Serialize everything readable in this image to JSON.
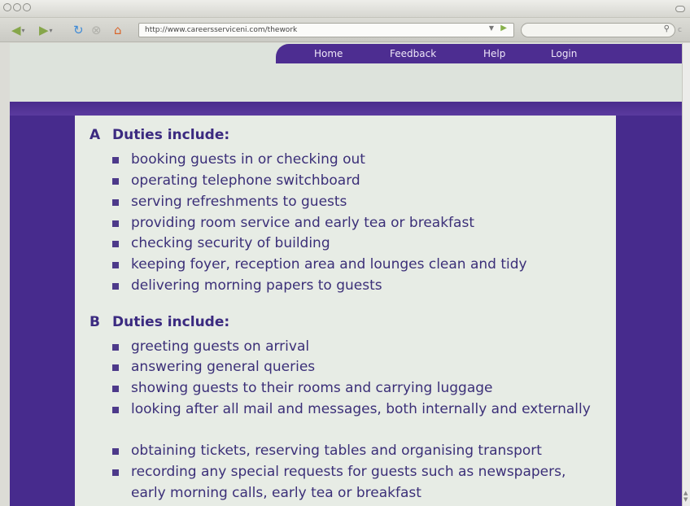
{
  "browser": {
    "url": "http://www.careersserviceni.com/thework"
  },
  "nav": {
    "home": "Home",
    "feedback": "Feedback",
    "help": "Help",
    "login": "Login"
  },
  "sections": [
    {
      "letter": "A",
      "heading": "Duties include:",
      "items": [
        "booking guests in or checking out",
        "operating telephone switchboard",
        "serving refreshments to guests",
        "providing room service and early tea or breakfast",
        "checking security of building",
        "keeping foyer, reception area and lounges clean and tidy",
        "delivering morning papers to guests"
      ]
    },
    {
      "letter": "B",
      "heading": "Duties include:",
      "items": [
        "greeting guests on arrival",
        "answering general queries",
        "showing guests to their rooms and carrying luggage",
        "looking after all mail and messages, both internally and externally",
        "obtaining tickets, reserving tables and organising transport",
        "recording any special requests for guests such as newspapers, early morning calls, early tea or breakfast"
      ]
    }
  ],
  "colors": {
    "brand_purple": "#4d2d91",
    "content_bg": "#e7ece5",
    "text": "#3b2f78"
  }
}
